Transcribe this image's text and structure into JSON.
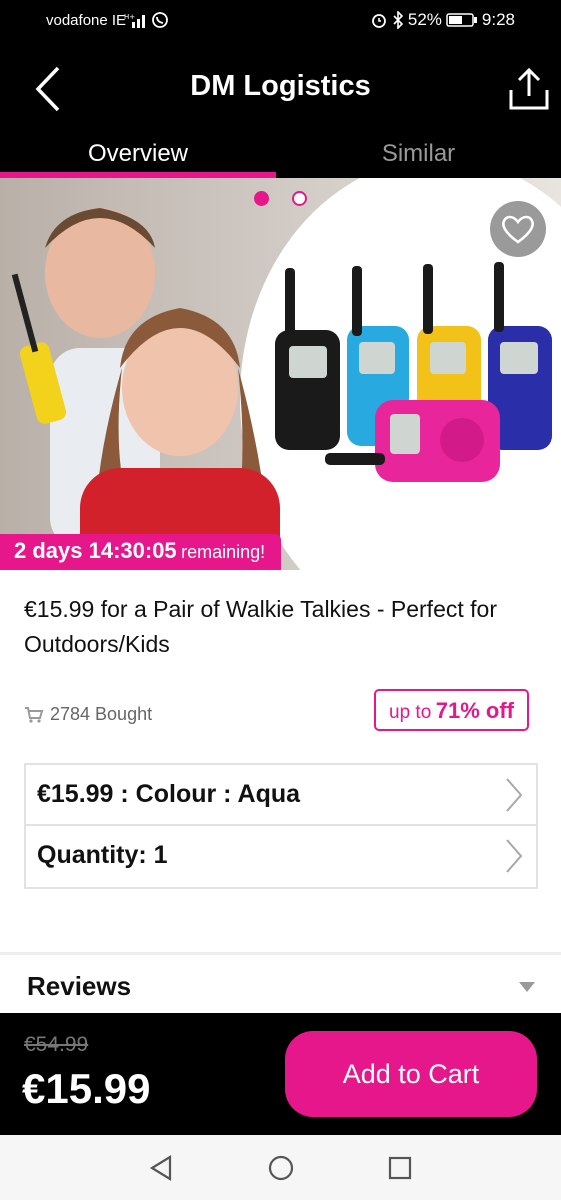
{
  "status_bar": {
    "carrier": "vodafone IE",
    "battery": "52%",
    "time": "9:28"
  },
  "header": {
    "title": "DM Logistics"
  },
  "tabs": [
    {
      "label": "Overview",
      "active": true
    },
    {
      "label": "Similar",
      "active": false
    }
  ],
  "gallery": {
    "current_slide": 1,
    "total_slides": 2
  },
  "countdown": {
    "time": "2 days 14:30:05",
    "suffix": "remaining!"
  },
  "product": {
    "title": "€15.99 for a Pair of Walkie Talkies - Perfect for Outdoors/Kids",
    "bought": "2784 Bought",
    "discount_prefix": "up to",
    "discount_value": "71% off"
  },
  "options": [
    {
      "label": "€15.99 : Colour : Aqua"
    },
    {
      "label": "Quantity: 1"
    }
  ],
  "reviews": {
    "title": "Reviews"
  },
  "purchase": {
    "original_price": "€54.99",
    "price": "€15.99",
    "add_to_cart_label": "Add to Cart"
  },
  "colors": {
    "accent": "#e6178a",
    "bar_background": "#000000"
  }
}
